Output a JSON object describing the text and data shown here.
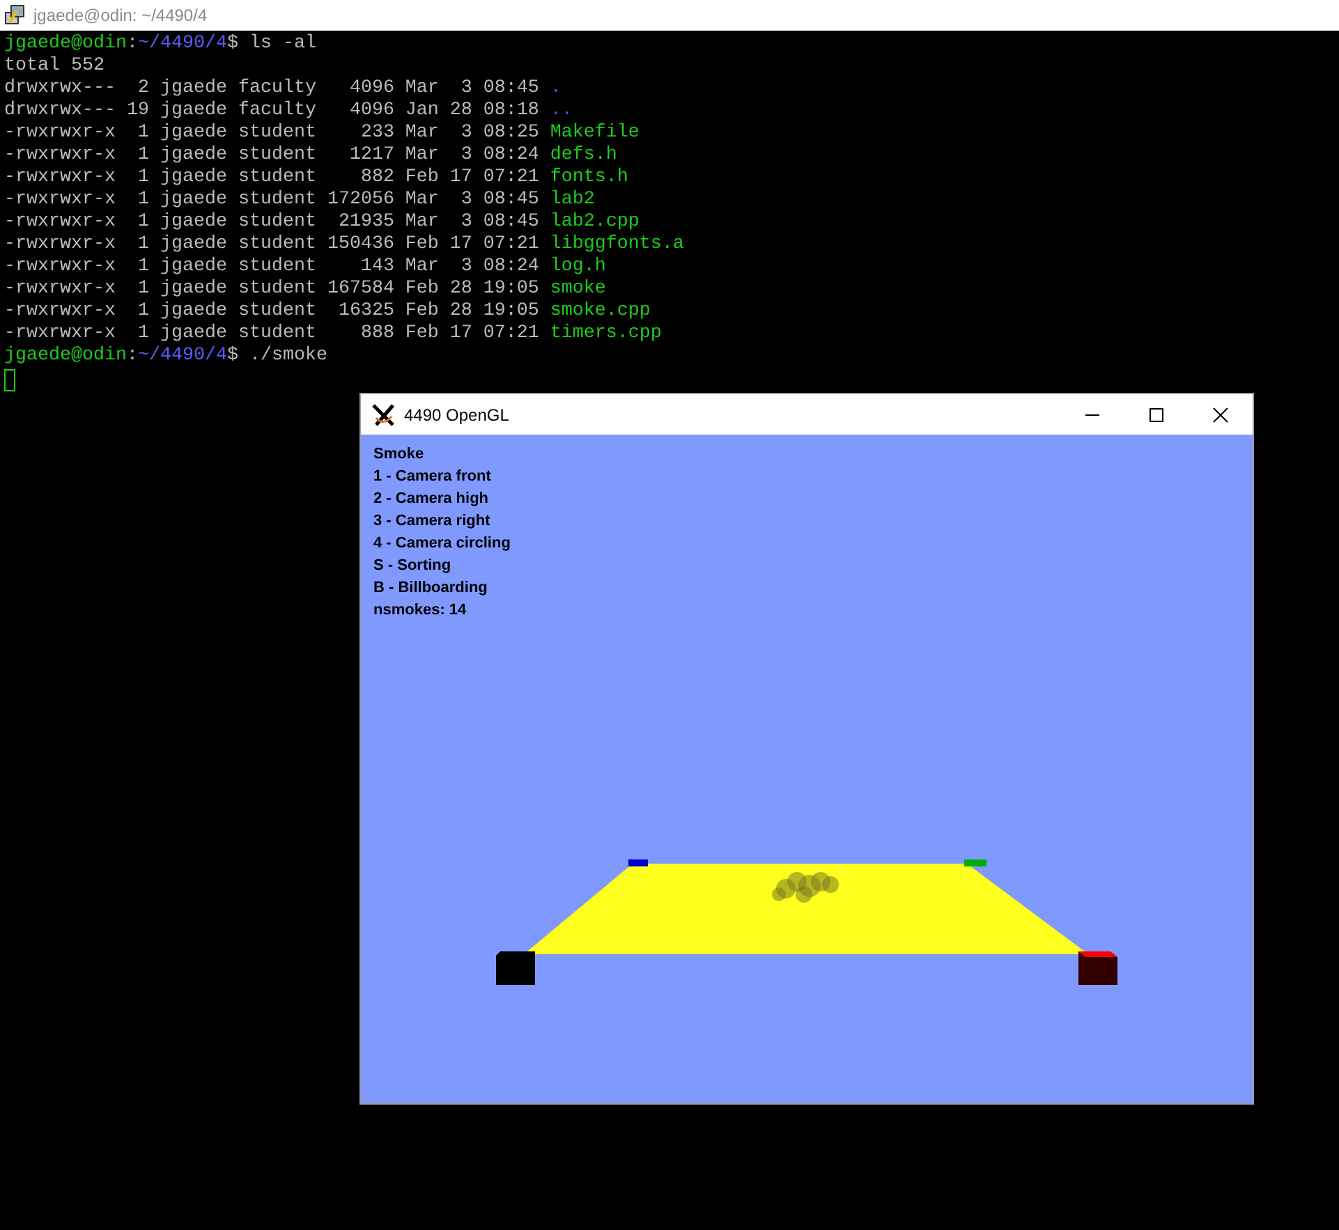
{
  "terminal": {
    "title": "jgaede@odin: ~/4490/4",
    "lines": [
      {
        "kind": "prompt",
        "segments": [
          {
            "text": "jgaede@odin",
            "kind": "user"
          },
          {
            "text": ":",
            "kind": "plain"
          },
          {
            "text": "~/4490/4",
            "kind": "path"
          },
          {
            "text": "$ ls -al",
            "kind": "plain"
          }
        ]
      },
      {
        "kind": "output",
        "segments": [
          {
            "text": "total 552",
            "kind": "plain"
          }
        ]
      },
      {
        "kind": "listing",
        "info": "drwxrwx---  2 jgaede faculty   4096 Mar  3 08:45",
        "name": ".",
        "directory": true
      },
      {
        "kind": "listing",
        "info": "drwxrwx--- 19 jgaede faculty   4096 Jan 28 08:18",
        "name": "..",
        "directory": true
      },
      {
        "kind": "listing",
        "info": "-rwxrwxr-x  1 jgaede student    233 Mar  3 08:25",
        "name": "Makefile",
        "directory": false
      },
      {
        "kind": "listing",
        "info": "-rwxrwxr-x  1 jgaede student   1217 Mar  3 08:24",
        "name": "defs.h",
        "directory": false
      },
      {
        "kind": "listing",
        "info": "-rwxrwxr-x  1 jgaede student    882 Feb 17 07:21",
        "name": "fonts.h",
        "directory": false
      },
      {
        "kind": "listing",
        "info": "-rwxrwxr-x  1 jgaede student 172056 Mar  3 08:45",
        "name": "lab2",
        "directory": false
      },
      {
        "kind": "listing",
        "info": "-rwxrwxr-x  1 jgaede student  21935 Mar  3 08:45",
        "name": "lab2.cpp",
        "directory": false
      },
      {
        "kind": "listing",
        "info": "-rwxrwxr-x  1 jgaede student 150436 Feb 17 07:21",
        "name": "libggfonts.a",
        "directory": false
      },
      {
        "kind": "listing",
        "info": "-rwxrwxr-x  1 jgaede student    143 Mar  3 08:24",
        "name": "log.h",
        "directory": false
      },
      {
        "kind": "listing",
        "info": "-rwxrwxr-x  1 jgaede student 167584 Feb 28 19:05",
        "name": "smoke",
        "directory": false
      },
      {
        "kind": "listing",
        "info": "-rwxrwxr-x  1 jgaede student  16325 Feb 28 19:05",
        "name": "smoke.cpp",
        "directory": false
      },
      {
        "kind": "listing",
        "info": "-rwxrwxr-x  1 jgaede student    888 Feb 17 07:21",
        "name": "timers.cpp",
        "directory": false
      },
      {
        "kind": "prompt",
        "segments": [
          {
            "text": "jgaede@odin",
            "kind": "user"
          },
          {
            "text": ":",
            "kind": "plain"
          },
          {
            "text": "~/4490/4",
            "kind": "path"
          },
          {
            "text": "$ ./smoke",
            "kind": "plain"
          }
        ]
      },
      {
        "kind": "cursor"
      }
    ]
  },
  "gl_window": {
    "title": "4490 OpenGL",
    "overlay_lines": [
      "Smoke",
      "1 - Camera front",
      "2 - Camera high",
      "3 - Camera right",
      "4 - Camera circling",
      "S - Sorting",
      "B - Billboarding",
      "nsmokes: 14"
    ]
  }
}
